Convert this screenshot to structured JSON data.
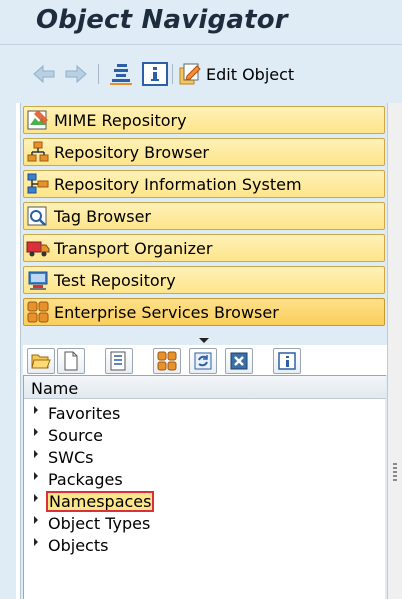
{
  "window": {
    "title": "Object Navigator"
  },
  "toolbar": {
    "edit_object_label": "Edit Object"
  },
  "nav_buttons": [
    {
      "label": "MIME Repository",
      "icon": "mime-repository-icon"
    },
    {
      "label": "Repository Browser",
      "icon": "repository-browser-icon"
    },
    {
      "label": "Repository Information System",
      "icon": "repository-info-system-icon"
    },
    {
      "label": "Tag Browser",
      "icon": "tag-browser-icon"
    },
    {
      "label": "Transport Organizer",
      "icon": "transport-organizer-icon"
    },
    {
      "label": "Test Repository",
      "icon": "test-repository-icon"
    },
    {
      "label": "Enterprise Services Browser",
      "icon": "enterprise-services-icon",
      "active": true
    }
  ],
  "tree": {
    "header": "Name",
    "items": [
      {
        "label": "Favorites"
      },
      {
        "label": "Source"
      },
      {
        "label": "SWCs"
      },
      {
        "label": "Packages"
      },
      {
        "label": "Namespaces",
        "selected": true
      },
      {
        "label": "Object Types"
      },
      {
        "label": "Objects"
      }
    ]
  },
  "colors": {
    "accent": "#fde58a",
    "selection_border": "#d9303a",
    "background": "#dfebf5"
  }
}
